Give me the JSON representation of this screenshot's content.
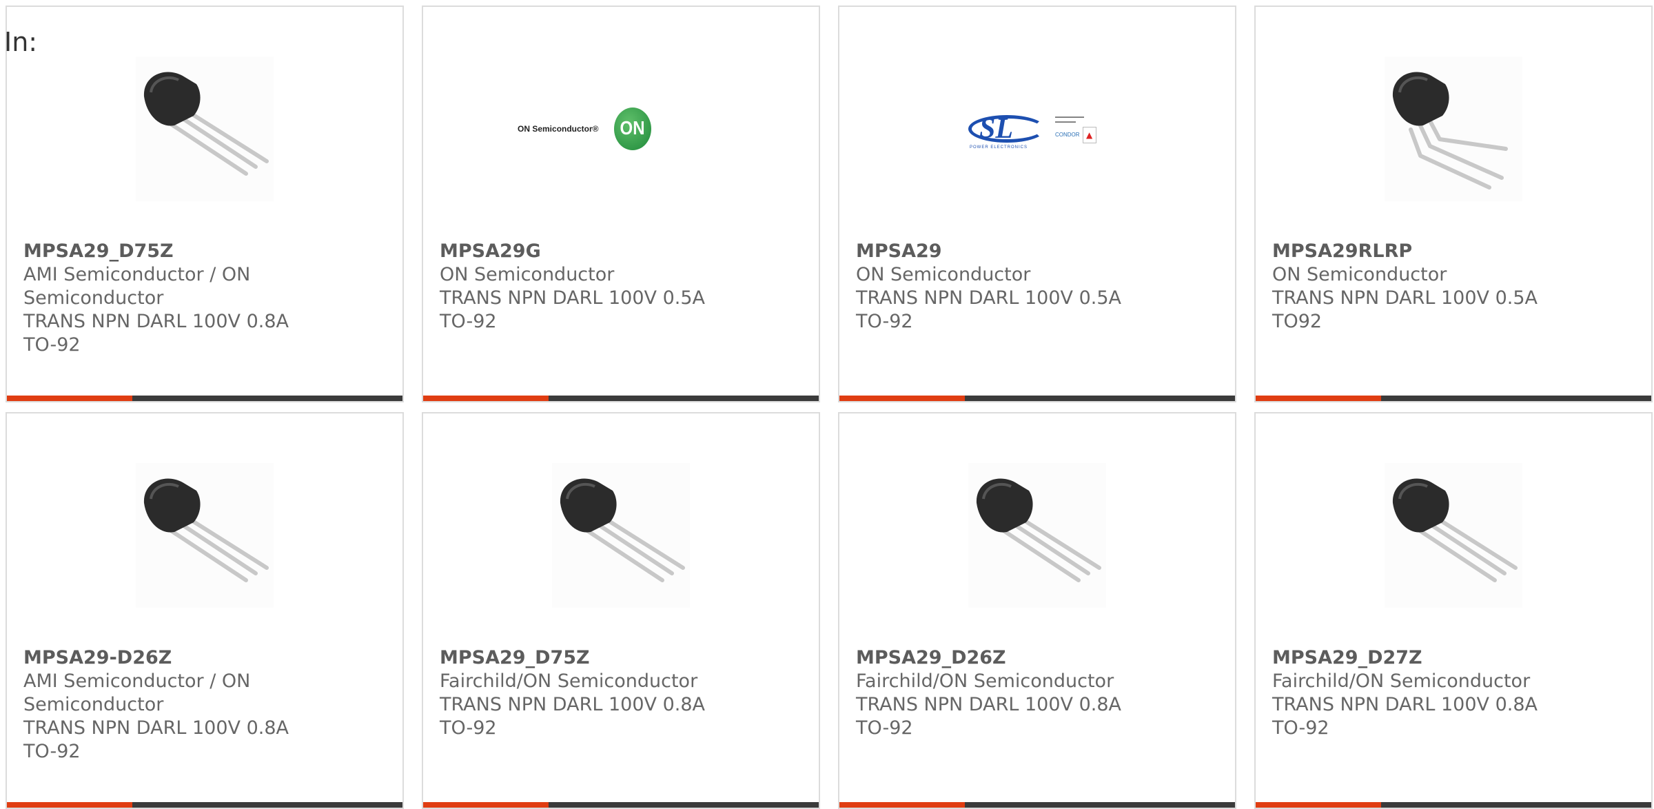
{
  "header": {
    "in_label": "In:"
  },
  "colors": {
    "accent": "#e03d12",
    "bar": "#3b3b3b",
    "card_border": "#dcdcdc",
    "text": "#666666"
  },
  "cards": [
    {
      "part_number": "MPSA29_D75Z",
      "manufacturer": "AMI Semiconductor / ON Semiconductor",
      "description": "TRANS NPN DARL 100V 0.8A TO-92",
      "image": "transistor-photo"
    },
    {
      "part_number": "MPSA29G",
      "manufacturer": "ON Semiconductor",
      "description": "TRANS NPN DARL 100V 0.5A TO-92",
      "image": "on-semiconductor-logo",
      "logo": {
        "wordmark": "ON Semiconductor®",
        "mark": "ON"
      }
    },
    {
      "part_number": "MPSA29",
      "manufacturer": "ON Semiconductor",
      "description": "TRANS NPN DARL 100V 0.5A TO-92",
      "image": "sl-power-electronics-logo",
      "logo": {
        "mark": "SL",
        "subtitle": "POWER ELECTRONICS",
        "brand2": "CONDOR"
      }
    },
    {
      "part_number": "MPSA29RLRP",
      "manufacturer": "ON Semiconductor",
      "description": "TRANS NPN DARL 100V 0.5A TO92",
      "image": "transistor-photo-bent-leads"
    },
    {
      "part_number": "MPSA29-D26Z",
      "manufacturer": "AMI Semiconductor / ON Semiconductor",
      "description": "TRANS NPN DARL 100V 0.8A TO-92",
      "image": "transistor-photo"
    },
    {
      "part_number": "MPSA29_D75Z",
      "manufacturer": "Fairchild/ON Semiconductor",
      "description": "TRANS NPN DARL 100V 0.8A TO-92",
      "image": "transistor-photo"
    },
    {
      "part_number": "MPSA29_D26Z",
      "manufacturer": "Fairchild/ON Semiconductor",
      "description": "TRANS NPN DARL 100V 0.8A TO-92",
      "image": "transistor-photo"
    },
    {
      "part_number": "MPSA29_D27Z",
      "manufacturer": "Fairchild/ON Semiconductor",
      "description": "TRANS NPN DARL 100V 0.8A TO-92",
      "image": "transistor-photo"
    }
  ]
}
